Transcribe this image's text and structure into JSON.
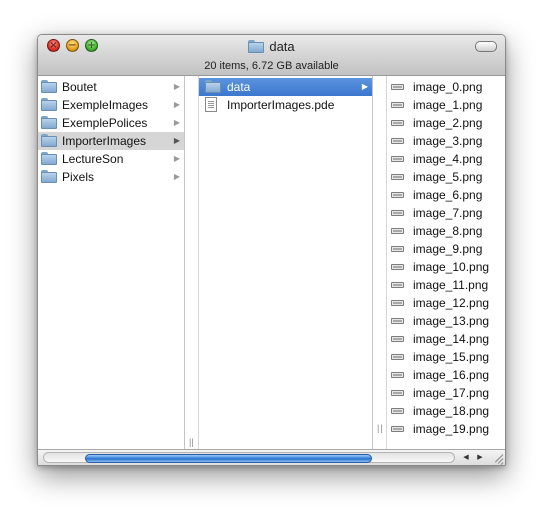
{
  "window": {
    "title": "data",
    "status": "20 items, 6.72 GB available",
    "close_glyph": "×",
    "minimize_glyph": "−",
    "zoom_glyph": "+"
  },
  "column1": {
    "items": [
      {
        "label": "Boutet",
        "icon": "folder-icon",
        "selected": false
      },
      {
        "label": "ExempleImages",
        "icon": "folder-icon",
        "selected": false
      },
      {
        "label": "ExemplePolices",
        "icon": "folder-icon",
        "selected": false
      },
      {
        "label": "ImporterImages",
        "icon": "folder-icon",
        "selected": true
      },
      {
        "label": "LectureSon",
        "icon": "folder-icon",
        "selected": false
      },
      {
        "label": "Pixels",
        "icon": "folder-icon",
        "selected": false
      }
    ]
  },
  "column2": {
    "items": [
      {
        "label": "data",
        "icon": "folder-icon",
        "selected": true
      },
      {
        "label": "ImporterImages.pde",
        "icon": "document-icon",
        "selected": false
      }
    ]
  },
  "column3": {
    "items": [
      {
        "label": "image_0.png",
        "icon": "png-file-icon"
      },
      {
        "label": "image_1.png",
        "icon": "png-file-icon"
      },
      {
        "label": "image_2.png",
        "icon": "png-file-icon"
      },
      {
        "label": "image_3.png",
        "icon": "png-file-icon"
      },
      {
        "label": "image_4.png",
        "icon": "png-file-icon"
      },
      {
        "label": "image_5.png",
        "icon": "png-file-icon"
      },
      {
        "label": "image_6.png",
        "icon": "png-file-icon"
      },
      {
        "label": "image_7.png",
        "icon": "png-file-icon"
      },
      {
        "label": "image_8.png",
        "icon": "png-file-icon"
      },
      {
        "label": "image_9.png",
        "icon": "png-file-icon"
      },
      {
        "label": "image_10.png",
        "icon": "png-file-icon"
      },
      {
        "label": "image_11.png",
        "icon": "png-file-icon"
      },
      {
        "label": "image_12.png",
        "icon": "png-file-icon"
      },
      {
        "label": "image_13.png",
        "icon": "png-file-icon"
      },
      {
        "label": "image_14.png",
        "icon": "png-file-icon"
      },
      {
        "label": "image_15.png",
        "icon": "png-file-icon"
      },
      {
        "label": "image_16.png",
        "icon": "png-file-icon"
      },
      {
        "label": "image_17.png",
        "icon": "png-file-icon"
      },
      {
        "label": "image_18.png",
        "icon": "png-file-icon"
      },
      {
        "label": "image_19.png",
        "icon": "png-file-icon"
      }
    ]
  },
  "scrollbar": {
    "left_arrow": "◀",
    "right_arrow": "▶",
    "position": 0.25,
    "visible_fraction": 0.7
  },
  "colors": {
    "selection_blue": "#3b77cf",
    "selection_gray": "#d6d6d6",
    "folder": "#82a9cf"
  }
}
